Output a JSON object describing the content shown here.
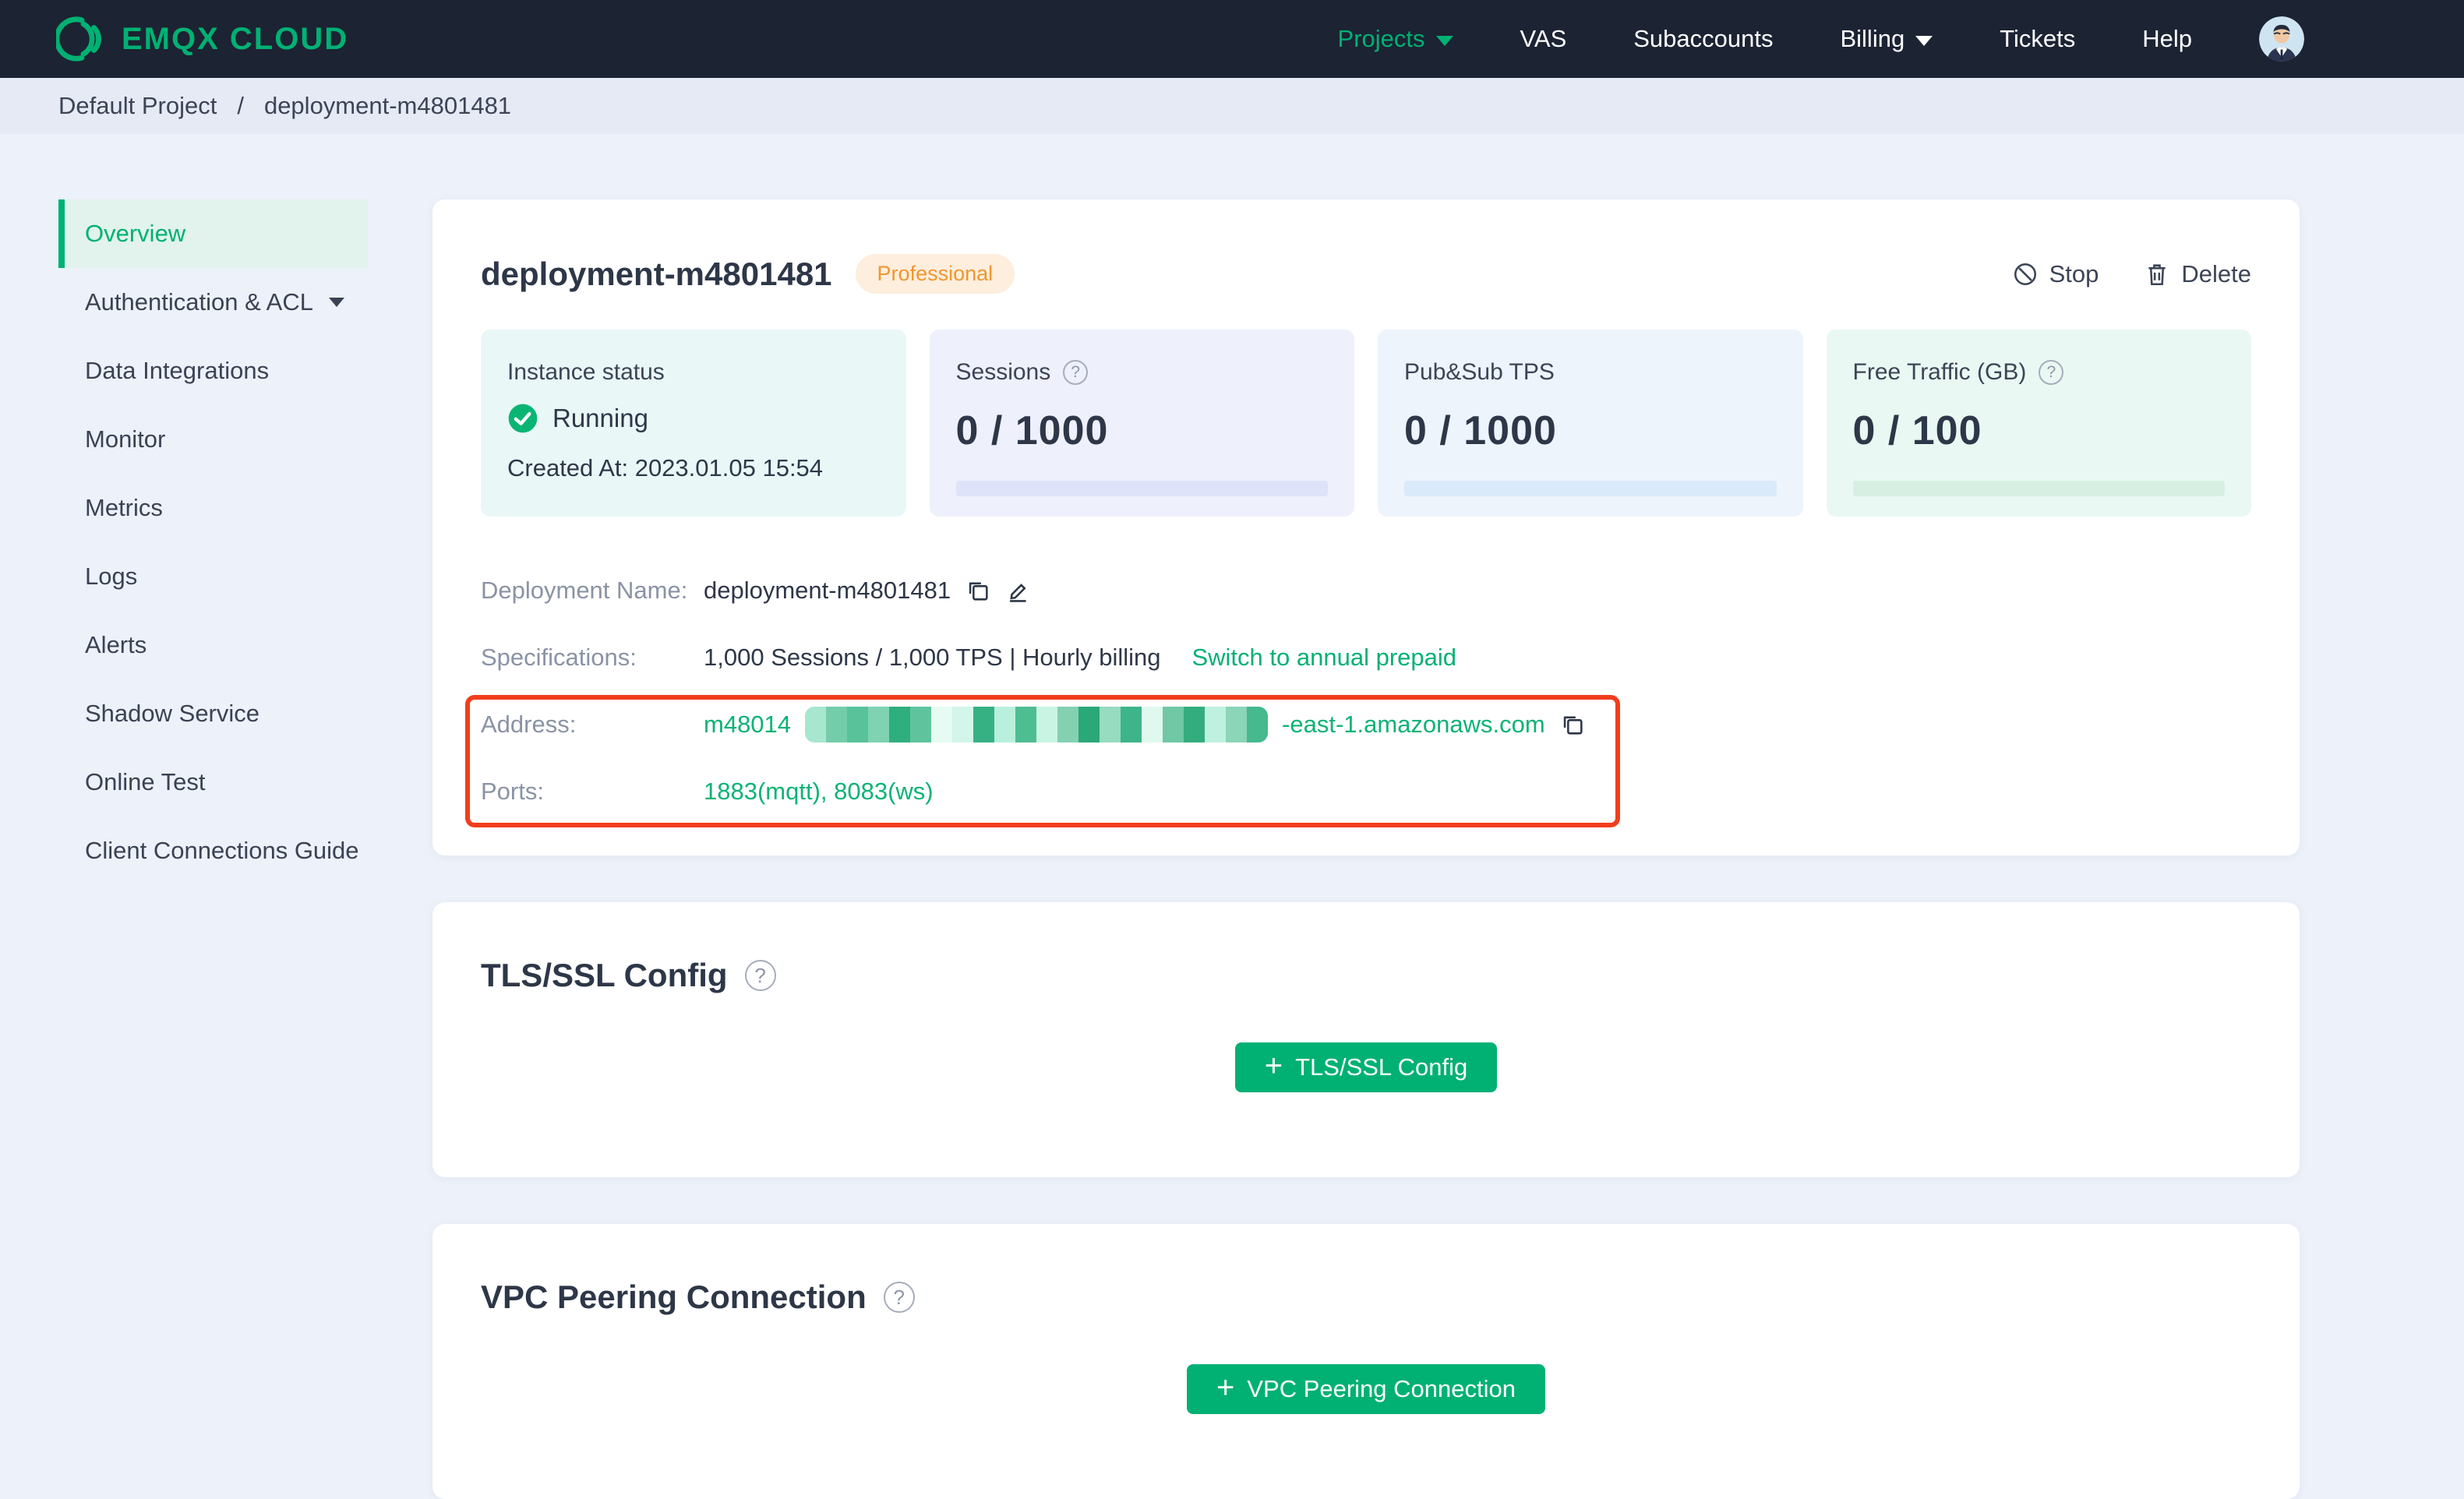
{
  "nav": {
    "brand": "EMQX CLOUD",
    "items": [
      {
        "label": "Projects"
      },
      {
        "label": "VAS"
      },
      {
        "label": "Subaccounts"
      },
      {
        "label": "Billing"
      },
      {
        "label": "Tickets"
      },
      {
        "label": "Help"
      }
    ]
  },
  "breadcrumb": {
    "project": "Default Project",
    "separator": "/",
    "current": "deployment-m4801481"
  },
  "sidebar": {
    "items": [
      {
        "label": "Overview"
      },
      {
        "label": "Authentication & ACL"
      },
      {
        "label": "Data Integrations"
      },
      {
        "label": "Monitor"
      },
      {
        "label": "Metrics"
      },
      {
        "label": "Logs"
      },
      {
        "label": "Alerts"
      },
      {
        "label": "Shadow Service"
      },
      {
        "label": "Online Test"
      },
      {
        "label": "Client Connections Guide"
      }
    ]
  },
  "deployment": {
    "title": "deployment-m4801481",
    "badge": "Professional",
    "actions": {
      "stop": "Stop",
      "delete": "Delete"
    },
    "stats": [
      {
        "label": "Instance status",
        "status": "Running",
        "created": "Created At: 2023.01.05 15:54"
      },
      {
        "label": "Sessions",
        "value": "0 / 1000"
      },
      {
        "label": "Pub&Sub TPS",
        "value": "0 / 1000"
      },
      {
        "label": "Free Traffic (GB)",
        "value": "0 / 100"
      }
    ],
    "details": {
      "name_label": "Deployment Name:",
      "name_value": "deployment-m4801481",
      "spec_label": "Specifications:",
      "spec_value": "1,000 Sessions / 1,000 TPS | Hourly billing",
      "spec_link": "Switch to annual prepaid",
      "address_label": "Address:",
      "address_prefix": "m48014",
      "address_suffix": "-east-1.amazonaws.com",
      "address_redacted_colors": [
        "#a7e6cf",
        "#74cdaa",
        "#58c29a",
        "#7fd2b2",
        "#2fae7e",
        "#5fc49e",
        "#e6fbf3",
        "#d2f6e9",
        "#36b183",
        "#b9f0dd",
        "#4fbd92",
        "#c9f4e4",
        "#83d1b1",
        "#2aa878",
        "#97dbc0",
        "#3db489",
        "#e0f9ef",
        "#70c8a5",
        "#34ad7e",
        "#bff1e0",
        "#8bd5b8",
        "#46b98e"
      ],
      "ports_label": "Ports:",
      "ports_value": "1883(mqtt), 8083(ws)"
    }
  },
  "tls": {
    "title": "TLS/SSL Config",
    "button": "TLS/SSL Config",
    "plus": "+"
  },
  "vpc": {
    "title": "VPC Peering Connection",
    "button": "VPC Peering Connection",
    "plus": "+"
  },
  "colors": {
    "accent_green": "#00b173",
    "nav_background": "#1c2333",
    "badge_background": "#fdeedd",
    "badge_text": "#f0962e",
    "annotation_red": "#f23d1d",
    "link_green": "#0cb375"
  }
}
